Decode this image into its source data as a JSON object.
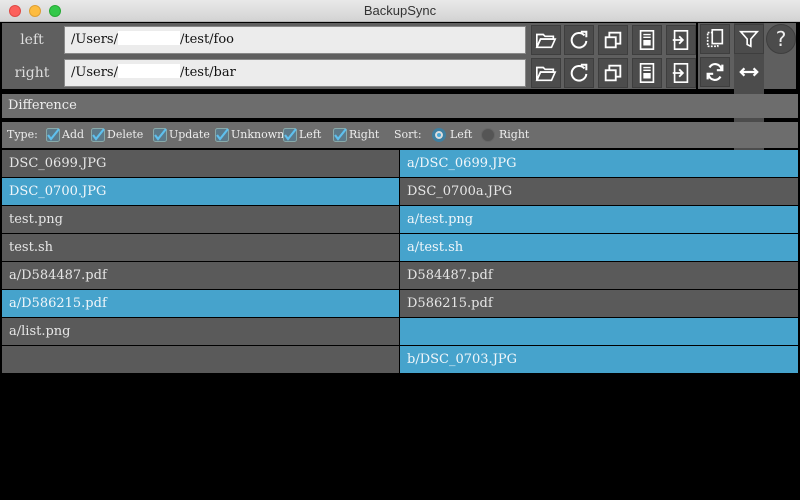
{
  "window": {
    "title": "BackupSync"
  },
  "paths": {
    "left": {
      "label": "left",
      "value_prefix": "/Users/",
      "value_suffix": "/test/foo"
    },
    "right": {
      "label": "right",
      "value_prefix": "/Users/",
      "value_suffix": "/test/bar"
    }
  },
  "side": {
    "help": "?"
  },
  "difference": {
    "label": "Difference"
  },
  "filter": {
    "type_label": "Type:",
    "add": "Add",
    "delete": "Delete",
    "update": "Update",
    "unknown": "Unknown",
    "left": "Left",
    "right": "Right",
    "sort_label": "Sort:",
    "sort_left": "Left",
    "sort_right": "Right",
    "sort_selected": "Left"
  },
  "rows": [
    {
      "left": "DSC_0699.JPG",
      "right": "a/DSC_0699.JPG",
      "left_color": "gray",
      "right_color": "blue"
    },
    {
      "left": "DSC_0700.JPG",
      "right": "DSC_0700a.JPG",
      "left_color": "blue",
      "right_color": "gray"
    },
    {
      "left": "test.png",
      "right": "a/test.png",
      "left_color": "gray",
      "right_color": "blue"
    },
    {
      "left": "test.sh",
      "right": "a/test.sh",
      "left_color": "gray",
      "right_color": "blue"
    },
    {
      "left": "a/D584487.pdf",
      "right": "D584487.pdf",
      "left_color": "gray",
      "right_color": "gray"
    },
    {
      "left": "a/D586215.pdf",
      "right": "D586215.pdf",
      "left_color": "blue",
      "right_color": "gray"
    },
    {
      "left": "a/list.png",
      "right": "",
      "left_color": "gray",
      "right_color": "blue"
    },
    {
      "left": "",
      "right": "b/DSC_0703.JPG",
      "left_color": "gray",
      "right_color": "blue"
    }
  ],
  "colors": {
    "accent": "#46a3cc",
    "row": "#5a5a5a",
    "panel": "#5f5f5f"
  }
}
